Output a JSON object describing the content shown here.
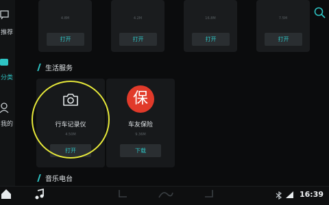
{
  "nav": {
    "items": [
      {
        "label": "推荐"
      },
      {
        "label": "分类"
      },
      {
        "label": "我的"
      }
    ]
  },
  "top_apps": [
    {
      "size": "4.8M",
      "action": "打开"
    },
    {
      "size": "4.2M",
      "action": "打开"
    },
    {
      "size": "16.8M",
      "action": "打开"
    },
    {
      "size": "7.5M",
      "action": "打开"
    }
  ],
  "sections": {
    "life": "生活服务",
    "music": "音乐电台"
  },
  "life_apps": [
    {
      "name": "行车记录仪",
      "size": "4.50M",
      "action": "打开"
    },
    {
      "name": "车友保险",
      "size": "9.36M",
      "action": "下载"
    }
  ],
  "insurance_logo_text": "保",
  "status": {
    "time": "16:39"
  },
  "colors": {
    "accent": "#2ec4c4",
    "highlight": "#e8ea3a",
    "insurance": "#e13a2a"
  }
}
